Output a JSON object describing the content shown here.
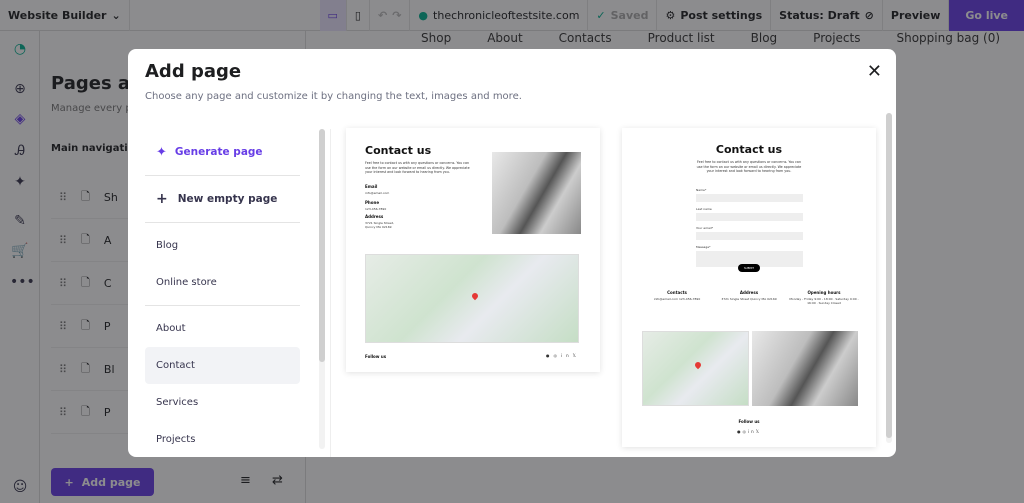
{
  "topbar": {
    "app": "Website Builder",
    "domain": "thechronicleoftestsite.com",
    "saved": "Saved",
    "post_settings": "Post settings",
    "status": "Status: Draft",
    "preview": "Preview",
    "go_live": "Go live"
  },
  "site_nav": [
    "Shop",
    "About",
    "Contacts",
    "Product list",
    "Blog",
    "Projects",
    "Shopping bag (0)"
  ],
  "panel": {
    "title": "Pages and",
    "subtitle": "Manage every pa",
    "section": "Main navigation",
    "rows": [
      "Sh",
      "A",
      "C",
      "P",
      "Bl",
      "P"
    ],
    "add_page": "Add page"
  },
  "modal": {
    "title": "Add page",
    "subtitle": "Choose any page and customize it by changing the text, images and more.",
    "generate": "Generate page",
    "new_empty": "New empty page",
    "group1": [
      "Blog",
      "Online store"
    ],
    "group2": [
      "About",
      "Contact",
      "Services",
      "Projects"
    ],
    "selected": "Contact",
    "accent": "#673de6"
  },
  "preview1": {
    "title": "Contact us",
    "intro": "Feel free to contact us with any questions or concerns. You can use the form on our website or email us directly. We appreciate your interest and look forward to hearing from you.",
    "email_label": "Email",
    "email": "info@email.com",
    "phone_label": "Phone",
    "phone": "123-456-7890",
    "address_label": "Address",
    "address": "3721 Single Street, Quincy MA 02169",
    "follow": "Follow us"
  },
  "preview2": {
    "title": "Contact us",
    "intro": "Feel free to contact us with any questions or concerns. You can use the form on our website or email us directly. We appreciate your interest and look forward to hearing from you.",
    "fields": [
      "Name*",
      "Last name",
      "Your email*",
      "Message*"
    ],
    "submit": "SUBMIT",
    "contacts_label": "Contacts",
    "contacts": "info@email.com 123-456-7890",
    "address_label": "Address",
    "address": "3721 Single Street Quincy MA 02169",
    "hours_label": "Opening hours",
    "hours": "Monday - Friday 9:00 - 18:00 · Saturday 9:00 - 16:00 · Sunday Closed",
    "follow": "Follow us"
  }
}
